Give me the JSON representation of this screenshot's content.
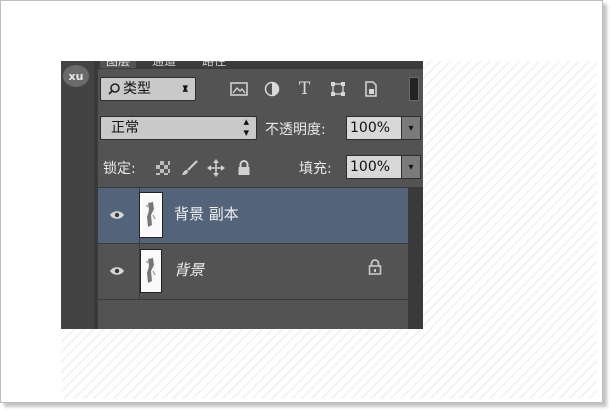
{
  "tabs": [
    "图层",
    "通道",
    "路径"
  ],
  "user": {
    "avatar_text": "xu"
  },
  "filter": {
    "kind_label": "类型",
    "search_icon": "magnifier-icon",
    "icons": [
      "image-filter-icon",
      "adjustment-filter-icon",
      "type-filter-icon",
      "shape-filter-icon",
      "smart-object-filter-icon"
    ]
  },
  "blend": {
    "mode": "正常",
    "opacity_label": "不透明度:",
    "opacity_value": "100%"
  },
  "lock": {
    "label": "锁定:",
    "icons": [
      "lock-transparent-pixels-icon",
      "lock-image-pixels-icon",
      "lock-position-icon",
      "lock-all-icon"
    ],
    "fill_label": "填充:",
    "fill_value": "100%"
  },
  "layers": [
    {
      "name": "背景 副本",
      "selected": true,
      "visible": true,
      "locked": false,
      "italic": false
    },
    {
      "name": "背景",
      "selected": false,
      "visible": true,
      "locked": true,
      "italic": true
    }
  ],
  "colors": {
    "panel_bg": "#535353",
    "selected_row": "#53647a",
    "input_bg": "#c9c9c9"
  }
}
